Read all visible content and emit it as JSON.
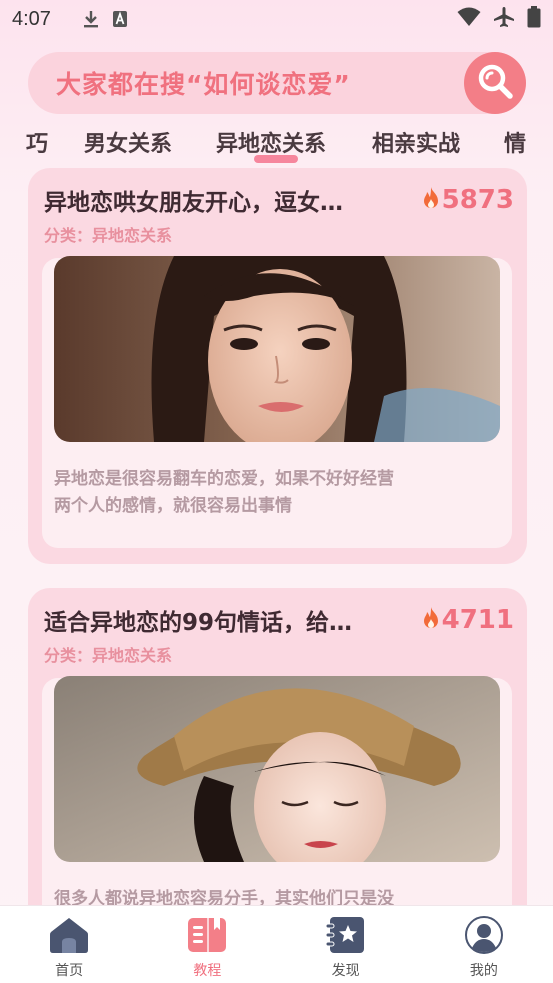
{
  "status_bar": {
    "time": "4:07"
  },
  "search": {
    "placeholder": "大家都在搜“如何谈恋爱”"
  },
  "tabs": {
    "items": [
      {
        "label": "巧"
      },
      {
        "label": "男女关系"
      },
      {
        "label": "异地恋关系"
      },
      {
        "label": "相亲实战"
      },
      {
        "label": "情"
      }
    ],
    "active_index": 2
  },
  "articles": [
    {
      "title": "异地恋哄女朋友开心，逗女…",
      "hot_count": "5873",
      "category": "分类：异地恋关系",
      "photo_icon": "portrait-photo",
      "description_line1": "异地恋是很容易翻车的恋爱，如果不好好经营",
      "description_line2": "两个人的感情，就很容易出事情"
    },
    {
      "title": "适合异地恋的99句情话，给…",
      "hot_count": "4711",
      "category": "分类：异地恋关系",
      "photo_icon": "portrait-photo",
      "description_line1": "很多人都说异地恋容易分手，其实他们只是没"
    }
  ],
  "bottom_nav": {
    "items": [
      {
        "label": "首页",
        "icon": "home-icon"
      },
      {
        "label": "教程",
        "icon": "book-icon"
      },
      {
        "label": "发现",
        "icon": "discover-icon"
      },
      {
        "label": "我的",
        "icon": "profile-icon"
      }
    ],
    "active_index": 1
  },
  "colors": {
    "accent": "#f0707f",
    "search_bg": "#fbd3dd",
    "card_bg": "#fbd9e2",
    "tab_indicator": "#f6869d"
  }
}
